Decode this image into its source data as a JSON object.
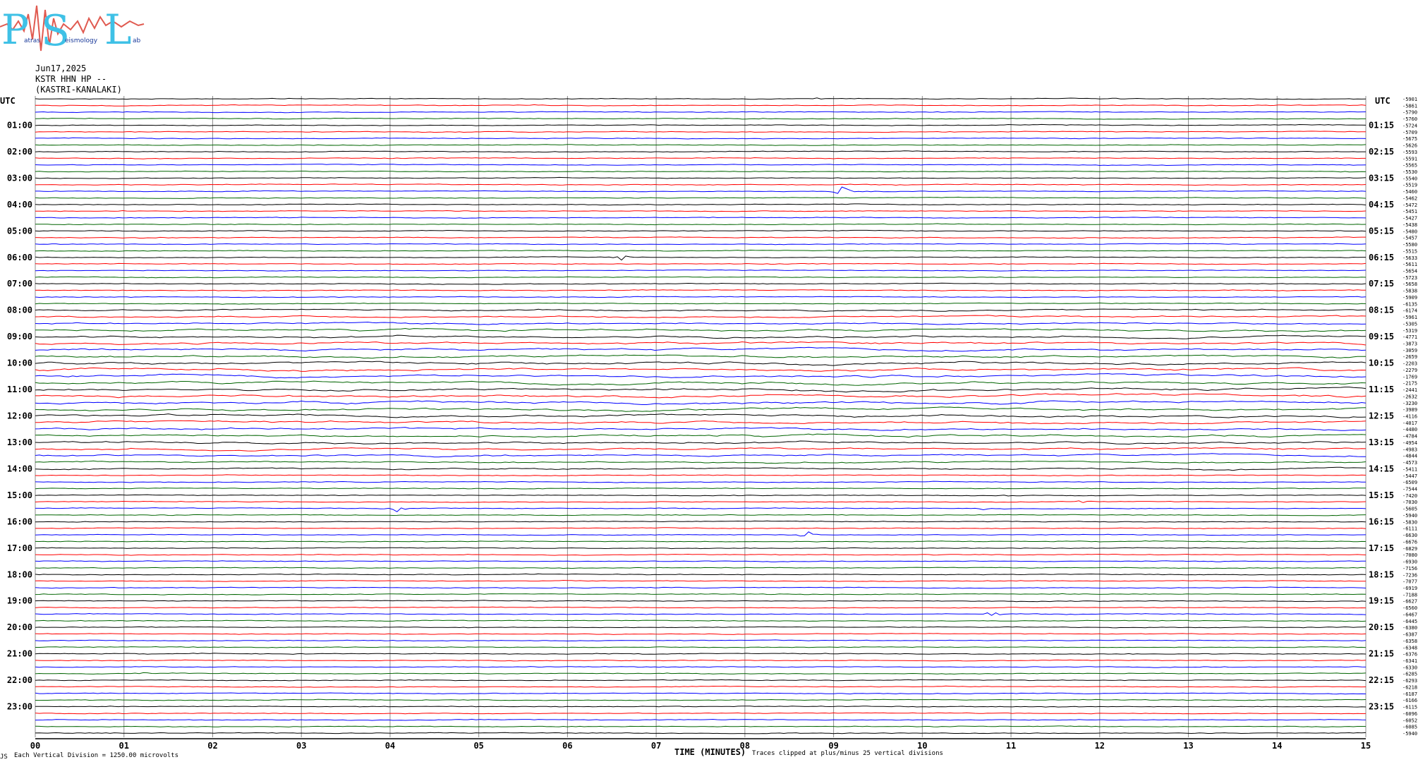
{
  "logo": {
    "letters": [
      "P",
      "S",
      "L"
    ],
    "small_text": [
      "atras",
      "eismology",
      "ab"
    ]
  },
  "header": {
    "date": "Jun17,2025",
    "station": "KSTR HHN HP --",
    "location": "(KASTRI-KANALAKI)",
    "utc_left": "UTC",
    "utc_right": "UTC"
  },
  "footer": {
    "vertical_division": "Each Vertical Division = 1250.00 microvolts",
    "x_axis_label": "TIME (MINUTES)",
    "clip_note": "Traces clipped at plus/minus 25 vertical divisions",
    "corner_mark": "JS"
  },
  "colors": {
    "black": "#000000",
    "red": "#ff0000",
    "blue": "#0000ff",
    "green": "#006400",
    "grid": "#8c8c8c"
  },
  "chart_data": {
    "type": "line",
    "title": "",
    "xlabel": "TIME (MINUTES)",
    "ylabel": "",
    "xlim": [
      0,
      15
    ],
    "x_ticks": [
      "00",
      "01",
      "02",
      "03",
      "04",
      "05",
      "06",
      "07",
      "08",
      "09",
      "10",
      "11",
      "12",
      "13",
      "14",
      "15"
    ],
    "trace_minutes": 15,
    "trace_color_cycle": [
      "black",
      "red",
      "blue",
      "green"
    ],
    "left_hour_labels": [
      "01:00",
      "02:00",
      "03:00",
      "04:00",
      "05:00",
      "06:00",
      "07:00",
      "08:00",
      "09:00",
      "10:00",
      "11:00",
      "12:00",
      "13:00",
      "14:00",
      "15:00",
      "16:00",
      "17:00",
      "18:00",
      "19:00",
      "20:00",
      "21:00",
      "22:00",
      "23:00"
    ],
    "right_hour_labels": [
      "01:15",
      "02:15",
      "03:15",
      "04:15",
      "05:15",
      "06:15",
      "07:15",
      "08:15",
      "09:15",
      "10:15",
      "11:15",
      "12:15",
      "13:15",
      "14:15",
      "15:15",
      "16:15",
      "17:15",
      "18:15",
      "19:15",
      "20:15",
      "21:15",
      "22:15",
      "23:15"
    ],
    "trace_offsets": [
      "-5901",
      "-5861",
      "-5790",
      "-5760",
      "-5724",
      "-5709",
      "-5675",
      "-5626",
      "-5593",
      "-5591",
      "-5565",
      "-5530",
      "-5540",
      "-5519",
      "-5460",
      "-5462",
      "-5472",
      "-5451",
      "-5427",
      "-5438",
      "-5480",
      "-5457",
      "-5580",
      "-5515",
      "-5633",
      "-5611",
      "-5654",
      "-5723",
      "-5658",
      "-5838",
      "-5909",
      "-6135",
      "-6174",
      "-5961",
      "-5305",
      "-5319",
      "-4771",
      "-3873",
      "-3059",
      "-2659",
      "-2203",
      "-2279",
      "-1769",
      "-2175",
      "-2441",
      "-2632",
      "-3230",
      "-3989",
      "-4116",
      "-4017",
      "-4480",
      "-4784",
      "-4954",
      "-4983",
      "-4844",
      "-4573",
      "-5411",
      "-5447",
      "-6509",
      "-7544",
      "-7420",
      "-7030",
      "-5605",
      "-5940",
      "-5830",
      "-6111",
      "-6630",
      "-6676",
      "-6829",
      "-7080",
      "-6930",
      "-7156",
      "-7236",
      "-7077",
      "-6919",
      "-7188",
      "-6627",
      "-6560",
      "-6467",
      "-6445",
      "-6380",
      "-6387",
      "-6358",
      "-6348",
      "-6376",
      "-6341",
      "-6330",
      "-6285",
      "-6293",
      "-6218",
      "-6187",
      "-6166",
      "-6115",
      "-6096",
      "-6052",
      "-6085",
      "-5940"
    ],
    "events": [
      {
        "trace": 0,
        "minute": 8.8,
        "amplitude": 0.8
      },
      {
        "trace": 0,
        "minute": 12.2,
        "amplitude": 0.7
      },
      {
        "trace": 14,
        "minute": 9.1,
        "amplitude": 3.5
      },
      {
        "trace": 24,
        "minute": 6.6,
        "amplitude": 2.5
      },
      {
        "trace": 56,
        "minute": 13.6,
        "amplitude": 1.4
      },
      {
        "trace": 60,
        "minute": 10.9,
        "amplitude": 1.2
      },
      {
        "trace": 61,
        "minute": 11.8,
        "amplitude": 1.4
      },
      {
        "trace": 62,
        "minute": 4.1,
        "amplitude": 3.0
      },
      {
        "trace": 62,
        "minute": 10.7,
        "amplitude": 1.6
      },
      {
        "trace": 66,
        "minute": 8.7,
        "amplitude": 2.5
      },
      {
        "trace": 70,
        "minute": 13.4,
        "amplitude": 1.5
      },
      {
        "trace": 78,
        "minute": 10.8,
        "amplitude": 2.0
      },
      {
        "trace": 87,
        "minute": 1.2,
        "amplitude": 2.0
      }
    ]
  }
}
